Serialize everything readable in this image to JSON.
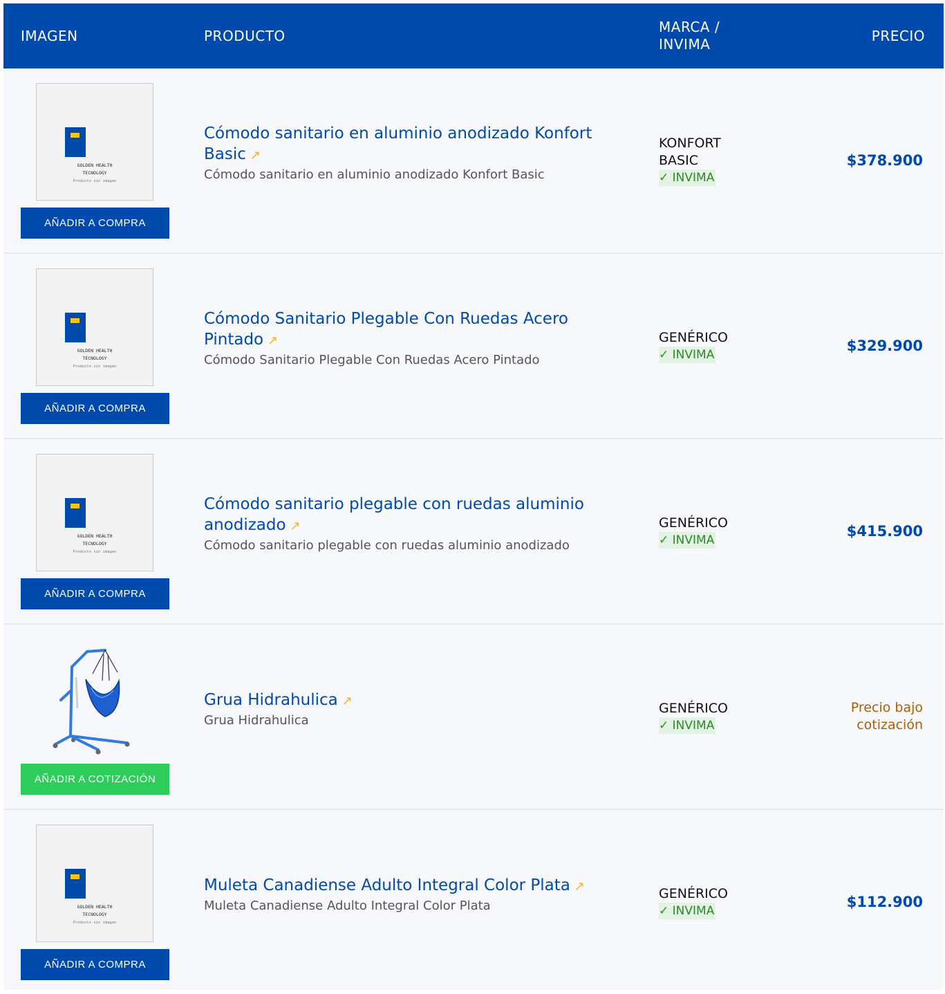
{
  "header": {
    "col_image": "IMAGEN",
    "col_product": "PRODUCTO",
    "col_brand": "MARCA / INVIMA",
    "col_price": "PRECIO"
  },
  "placeholder": {
    "title": "GOLDEN HEALTH\nTECNOLOGY",
    "subtitle": "Producto sin imagen"
  },
  "rows": [
    {
      "title": "Cómodo sanitario en aluminio anodizado Konfort Basic",
      "arrow": "↗",
      "description": "Cómodo sanitario en aluminio anodizado Konfort Basic",
      "brand": "KONFORT BASIC",
      "invima": "✓ INVIMA",
      "price": "$378.900",
      "button": "AÑADIR A COMPRA"
    },
    {
      "title": "Cómodo Sanitario Plegable Con Ruedas Acero Pintado",
      "arrow": "↗",
      "description": "Cómodo Sanitario Plegable Con Ruedas Acero Pintado",
      "brand": "GENÉRICO",
      "invima": "✓ INVIMA",
      "price": "$329.900",
      "button": "AÑADIR A COMPRA"
    },
    {
      "title": "Cómodo sanitario plegable con ruedas aluminio anodizado",
      "arrow": "↗",
      "description": "Cómodo sanitario plegable con ruedas aluminio anodizado",
      "brand": "GENÉRICO",
      "invima": "✓ INVIMA",
      "price": "$415.900",
      "button": "AÑADIR A COMPRA"
    },
    {
      "title": "Grua Hidrahulica",
      "arrow": "↗",
      "description": "Grua Hidrahulica",
      "brand": "GENÉRICO",
      "invima": "✓ INVIMA",
      "price": "Precio bajo cotización",
      "button": "AÑADIR A COTIZACIÓN"
    },
    {
      "title": "Muleta Canadiense Adulto Integral Color Plata",
      "arrow": "↗",
      "description": "Muleta Canadiense Adulto Integral Color Plata",
      "brand": "GENÉRICO",
      "invima": "✓ INVIMA",
      "price": "$112.900",
      "button": "AÑADIR A COMPRA"
    }
  ],
  "colors": {
    "primary": "#004aad",
    "quote_button": "#2ecc5b",
    "invima_green": "#2a8a2a",
    "quote_price": "#b35c00",
    "arrow": "#f0b323"
  }
}
